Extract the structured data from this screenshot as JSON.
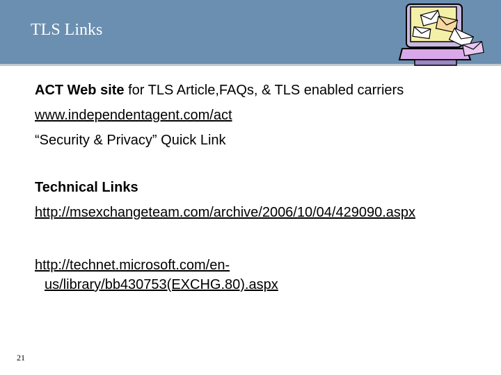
{
  "slide": {
    "title": "TLS Links",
    "page_number": "21",
    "icon": "computer-with-mail-icon"
  },
  "content": {
    "act_bold": "ACT Web site",
    "act_rest": " for TLS Article,FAQs, & TLS enabled carriers",
    "act_url": "www.independentagent.com/act",
    "quick_link": "“Security & Privacy” Quick Link",
    "technical_heading": "Technical Links",
    "link1": "http://msexchangeteam.com/archive/2006/10/04/429090.aspx",
    "link2_line1": "http://technet.microsoft.com/en-",
    "link2_line2": "us/library/bb430753(EXCHG.80).aspx"
  },
  "colors": {
    "title_bar": "#6b8fb0",
    "text": "#000000"
  }
}
